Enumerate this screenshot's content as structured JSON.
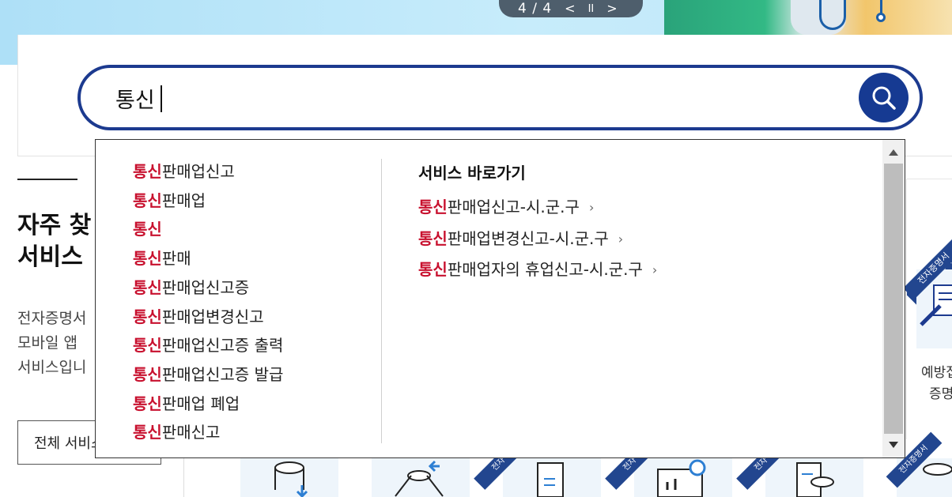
{
  "slider": {
    "counter": "4 / 4",
    "prev_label": "<",
    "pause_label": "II",
    "next_label": ">"
  },
  "search": {
    "value": "통신"
  },
  "faq": {
    "title_line1": "자주 찾",
    "title_line2": "서비스",
    "desc_line1": "전자증명서",
    "desc_line2": "모바일 앱",
    "desc_line3": "서비스입니",
    "all_button": "전체 서비스"
  },
  "right_card": {
    "ribbon": "전자증명서",
    "label_line1": "예방접",
    "label_line2": "증명"
  },
  "bottom_ribbons": [
    "전자",
    "전자",
    "전자",
    "전자증명서"
  ],
  "autocomplete": {
    "keyword": "통신",
    "suggestions": [
      {
        "highlight": "통신",
        "rest": "판매업신고"
      },
      {
        "highlight": "통신",
        "rest": "판매업"
      },
      {
        "highlight": "통신",
        "rest": ""
      },
      {
        "highlight": "통신",
        "rest": "판매"
      },
      {
        "highlight": "통신",
        "rest": "판매업신고증"
      },
      {
        "highlight": "통신",
        "rest": "판매업변경신고"
      },
      {
        "highlight": "통신",
        "rest": "판매업신고증 출력"
      },
      {
        "highlight": "통신",
        "rest": "판매업신고증 발급"
      },
      {
        "highlight": "통신",
        "rest": "판매업 폐업"
      },
      {
        "highlight": "통신",
        "rest": "판매신고"
      }
    ],
    "shortcut_title": "서비스 바로가기",
    "shortcuts": [
      {
        "highlight": "통신",
        "rest": "판매업신고-시.군.구"
      },
      {
        "highlight": "통신",
        "rest": "판매업변경신고-시.군.구"
      },
      {
        "highlight": "통신",
        "rest": "판매업자의 휴업신고-시.군.구"
      }
    ]
  },
  "colors": {
    "accent": "#1c3a8f",
    "highlight": "#c8102e"
  }
}
